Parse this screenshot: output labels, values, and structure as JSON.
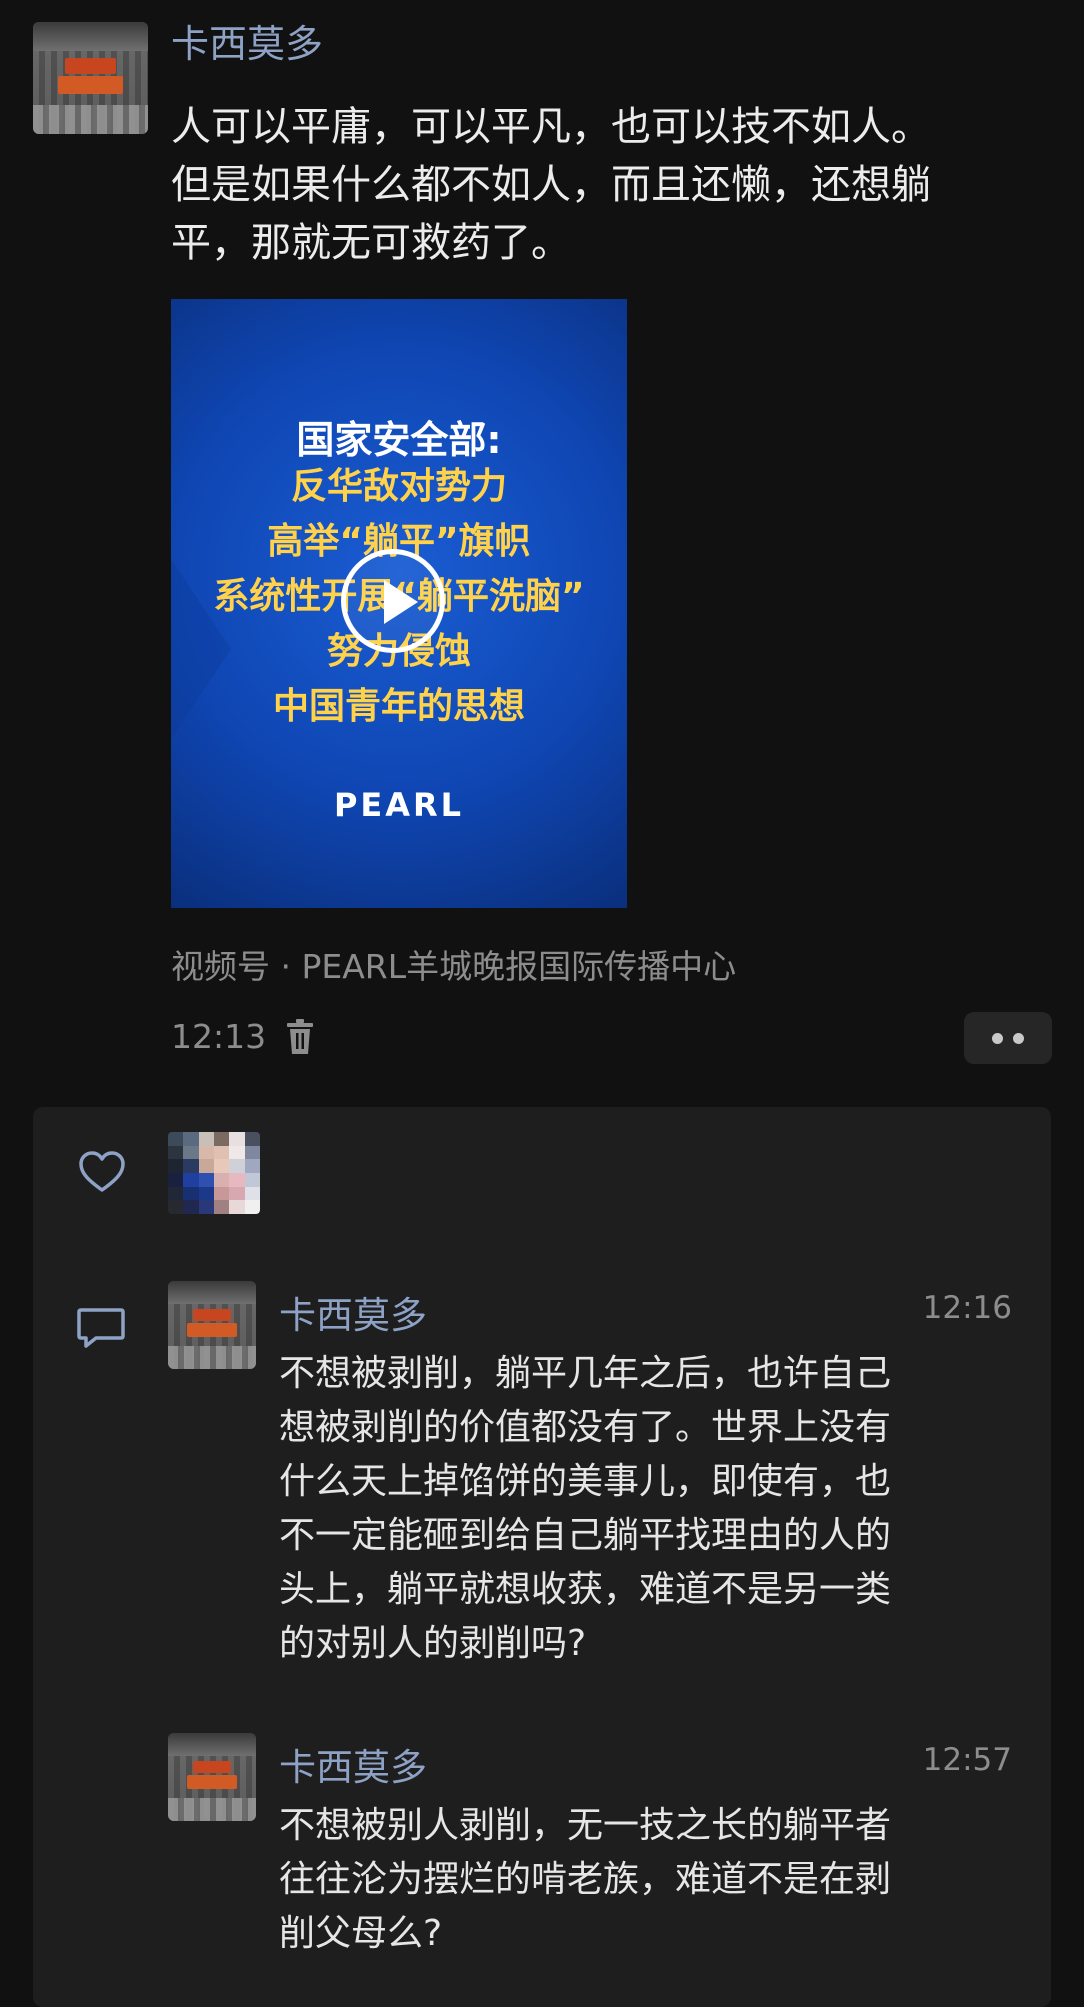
{
  "post": {
    "author": "卡西莫多",
    "text": "人可以平庸，可以平凡，也可以技不如人。\n但是如果什么都不如人，而且还懒，还想躺\n平，那就无可救药了。",
    "video": {
      "headline_white": "国家安全部:",
      "headline_lines": [
        "反华敌对势力",
        "高举“躺平”旗帜",
        "系统性开展“躺平洗脑”",
        "努力侵蚀",
        "中国青年的思想"
      ],
      "brand": "PEARL"
    },
    "source": "视频号 · PEARL羊城晚报国际传播中心",
    "time": "12:13"
  },
  "comments": [
    {
      "author": "卡西莫多",
      "time": "12:16",
      "text": "不想被剥削，躺平几年之后，也许自己\n想被剥削的价值都没有了。世界上没有\n什么天上掉馅饼的美事儿，即使有，也\n不一定能砸到给自己躺平找理由的人的\n头上，躺平就想收获，难道不是另一类\n的对别人的剥削吗?"
    },
    {
      "author": "卡西莫多",
      "time": "12:57",
      "text": "不想被别人剥削，无一技之长的躺平者\n往往沦为摆烂的啃老族，难道不是在剥\n削父母么?"
    }
  ],
  "colors": {
    "background": "#111111",
    "name": "#8ea2c6",
    "panel": "#1e1e1e"
  }
}
